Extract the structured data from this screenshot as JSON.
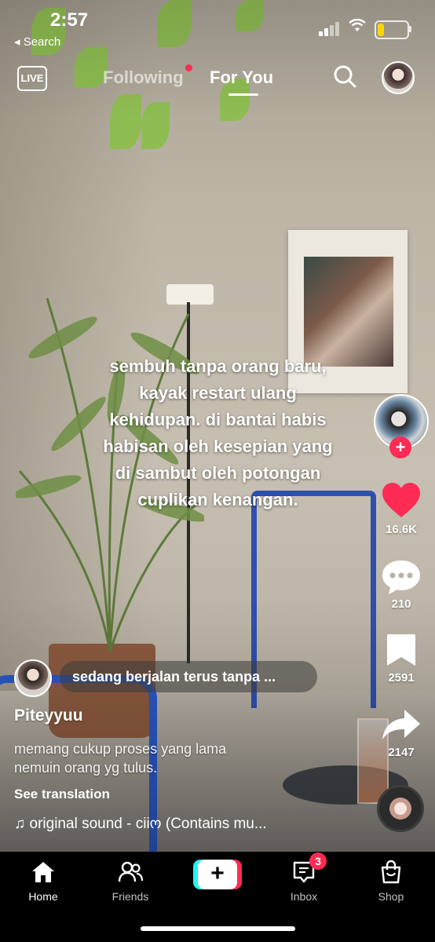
{
  "status_bar": {
    "time": "2:57",
    "back_label": "◂ Search"
  },
  "top_nav": {
    "live_label": "LIVE",
    "tabs": [
      {
        "label": "Following",
        "active": false,
        "has_dot": true
      },
      {
        "label": "For You",
        "active": true
      }
    ]
  },
  "video": {
    "caption_lines": [
      "sembuh tanpa orang baru,",
      "kayak restart ulang",
      "kehidupan.  di bantai habis",
      "habisan oleh kesepian yang",
      "di sambut oleh potongan",
      "cuplikan kenangan."
    ]
  },
  "actions": {
    "likes": "16.6K",
    "comments": "210",
    "bookmarks": "2591",
    "shares": "2147"
  },
  "now_playing": {
    "text": "sedang berjalan terus tanpa ..."
  },
  "post": {
    "username": "Piteyyuu",
    "description_lines": [
      "memang cukup proses yang lama",
      "nemuin orang yg tulus."
    ],
    "see_translation": "See translation",
    "sound": "♫ original sound - ciiო (Contains mu..."
  },
  "bottom_nav": {
    "items": [
      {
        "label": "Home",
        "active": true
      },
      {
        "label": "Friends",
        "active": false
      },
      {
        "label": "Inbox",
        "active": false,
        "badge": "3"
      },
      {
        "label": "Shop",
        "active": false
      }
    ]
  },
  "colors": {
    "accent_red": "#fe2c55",
    "accent_cyan": "#25f4ee",
    "battery_yellow": "#ffd60a"
  }
}
